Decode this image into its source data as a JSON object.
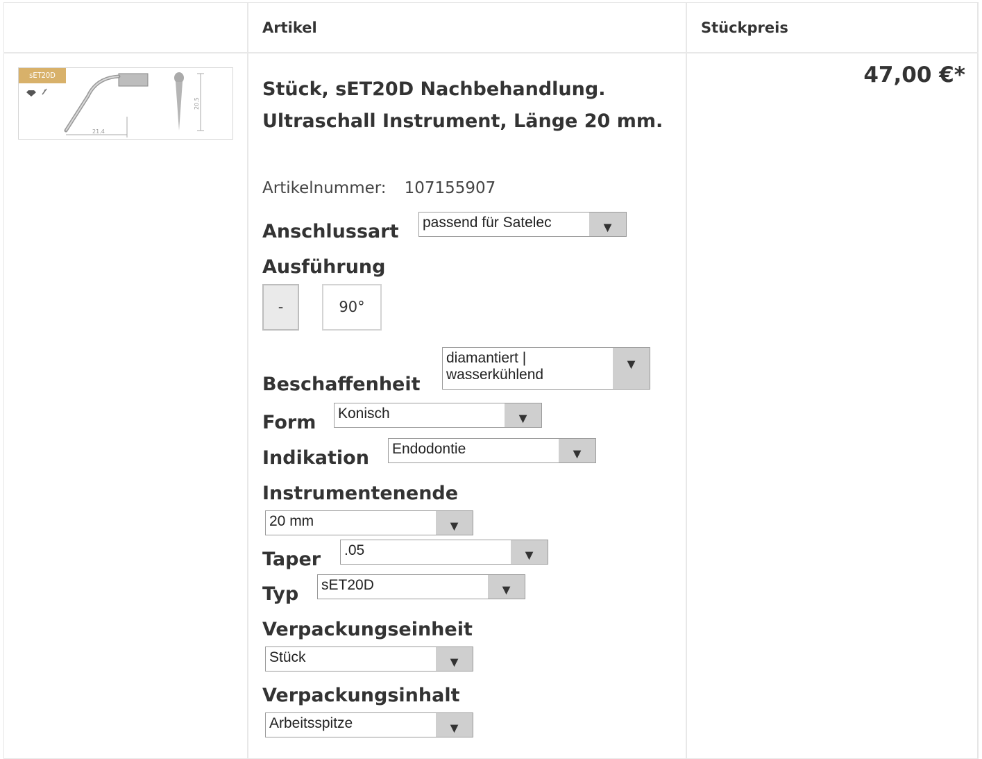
{
  "header": {
    "col_article": "Artikel",
    "col_unit_price": "Stückpreis"
  },
  "product": {
    "badge": "sET20D",
    "dim_horizontal": "21.4",
    "dim_vertical": "20.5",
    "title": "Stück, sET20D Nachbehandlung. Ultraschall Instrument, Länge 20 mm.",
    "article_number_label": "Artikelnummer:",
    "article_number": "107155907",
    "price": "47,00 €*"
  },
  "options": {
    "anschlussart": {
      "label": "Anschlussart",
      "value": "passend für Satelec"
    },
    "ausfuehrung": {
      "label": "Ausführung",
      "btn_a": "-",
      "btn_b": "90°",
      "selected": "-"
    },
    "beschaffenheit": {
      "label": "Beschaffenheit",
      "value": "diamantiert | wasserkühlend"
    },
    "form": {
      "label": "Form",
      "value": "Konisch"
    },
    "indikation": {
      "label": "Indikation",
      "value": "Endodontie"
    },
    "instrumentenende": {
      "label": "Instrumentenende",
      "value": "20 mm"
    },
    "taper": {
      "label": "Taper",
      "value": ".05"
    },
    "typ": {
      "label": "Typ",
      "value": "sET20D"
    },
    "verpackungseinheit": {
      "label": "Verpackungseinheit",
      "value": "Stück"
    },
    "verpackungsinhalt": {
      "label": "Verpackungsinhalt",
      "value": "Arbeitsspitze"
    }
  },
  "icons": {
    "dropdown_arrow": "▼"
  },
  "colors": {
    "badge": "#d8b16a",
    "border": "#e6e6e6",
    "select_arrow_bg": "#cfcfcf"
  }
}
